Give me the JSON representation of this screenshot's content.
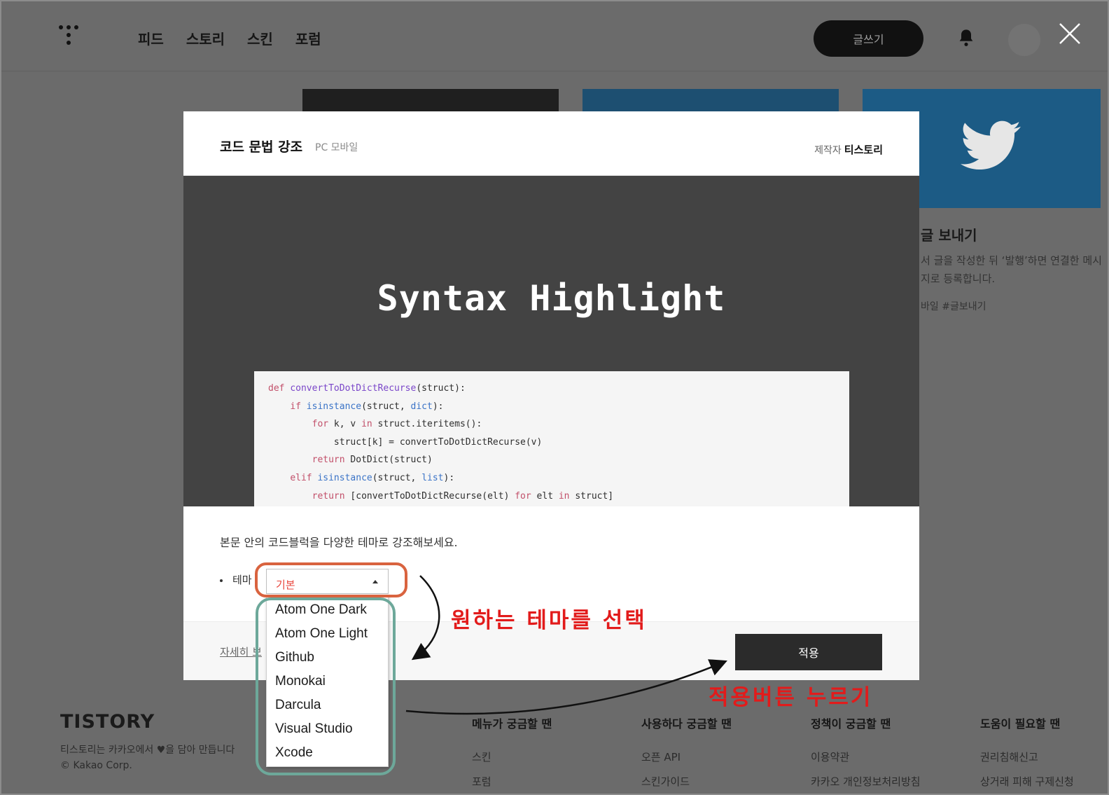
{
  "topbar": {
    "nav": [
      "피드",
      "스토리",
      "스킨",
      "포럼"
    ],
    "write_label": "글쓰기"
  },
  "background_card": {
    "title": "글 보내기",
    "desc": "서 글을 작성한 뒤 ‘발행’하면 연결한 메시지로 등록합니다.",
    "tags": "바일  #글보내기"
  },
  "modal": {
    "title": "코드 문법 강조",
    "platforms": "PC 모바일",
    "author_label": "제작자",
    "author": "티스토리",
    "preview_title": "Syntax Highlight",
    "description": "본문 안의 코드블럭을 다양한 테마로 강조해보세요.",
    "theme_label": "테마",
    "theme_selected": "기본",
    "theme_options": [
      "Atom One Dark",
      "Atom One Light",
      "Github",
      "Monokai",
      "Darcula",
      "Visual Studio",
      "Xcode"
    ],
    "detail_link": "자세히 보",
    "apply_label": "적용"
  },
  "code_sample": [
    "def convertToDotDictRecurse(struct):",
    "    if isinstance(struct, dict):",
    "        for k, v in struct.iteritems():",
    "            struct[k] = convertToDotDictRecurse(v)",
    "        return DotDict(struct)",
    "    elif isinstance(struct, list):",
    "        return [convertToDotDictRecurse(elt) for elt in struct]"
  ],
  "annotations": {
    "select_theme": "원하는 테마를 선택",
    "press_apply": "적용버튼 누르기"
  },
  "footer": {
    "brand": "TISTORY",
    "tagline": "티스토리는 카카오에서 ♥을 담아 만듭니다",
    "copyright": "© Kakao Corp.",
    "columns": [
      {
        "title": "메뉴가 궁금할 땐",
        "links": [
          "스킨",
          "포럼"
        ]
      },
      {
        "title": "사용하다 궁금할 땐",
        "links": [
          "오픈 API",
          "스킨가이드"
        ]
      },
      {
        "title": "정책이 궁금할 땐",
        "links": [
          "이용약관",
          "카카오 개인정보처리방침"
        ]
      },
      {
        "title": "도움이 필요할 땐",
        "links": [
          "권리침해신고",
          "상거래 피해 구제신청"
        ]
      }
    ]
  },
  "colors": {
    "overlay": "#6b6b6b",
    "accent_red": "#e21b1b",
    "annotation_orange": "#d9633f",
    "annotation_green": "#6da89a"
  }
}
